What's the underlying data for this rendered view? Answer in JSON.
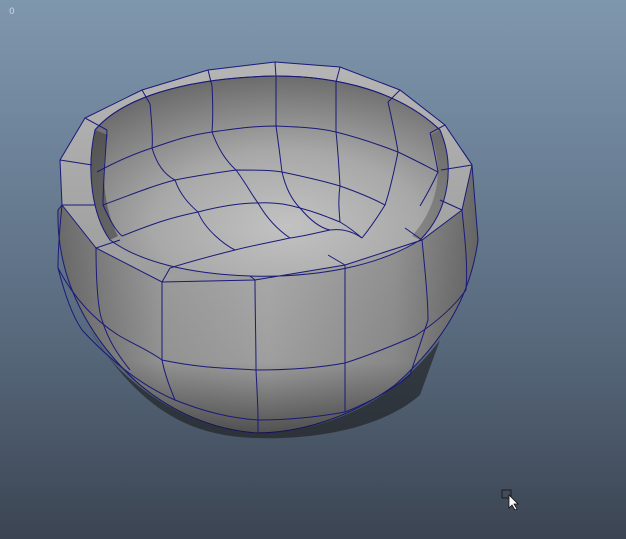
{
  "viewport": {
    "corner_label": "0",
    "colors": {
      "background_top": "#7f97ad",
      "background_bottom": "#3b4452",
      "wireframe": "#1a1a7a",
      "surface": "#9a9a9a"
    }
  },
  "scene": {
    "object": "bowl-mesh",
    "display": "shaded-with-wireframe"
  },
  "cursor": {
    "icon": "select-cursor-icon"
  }
}
